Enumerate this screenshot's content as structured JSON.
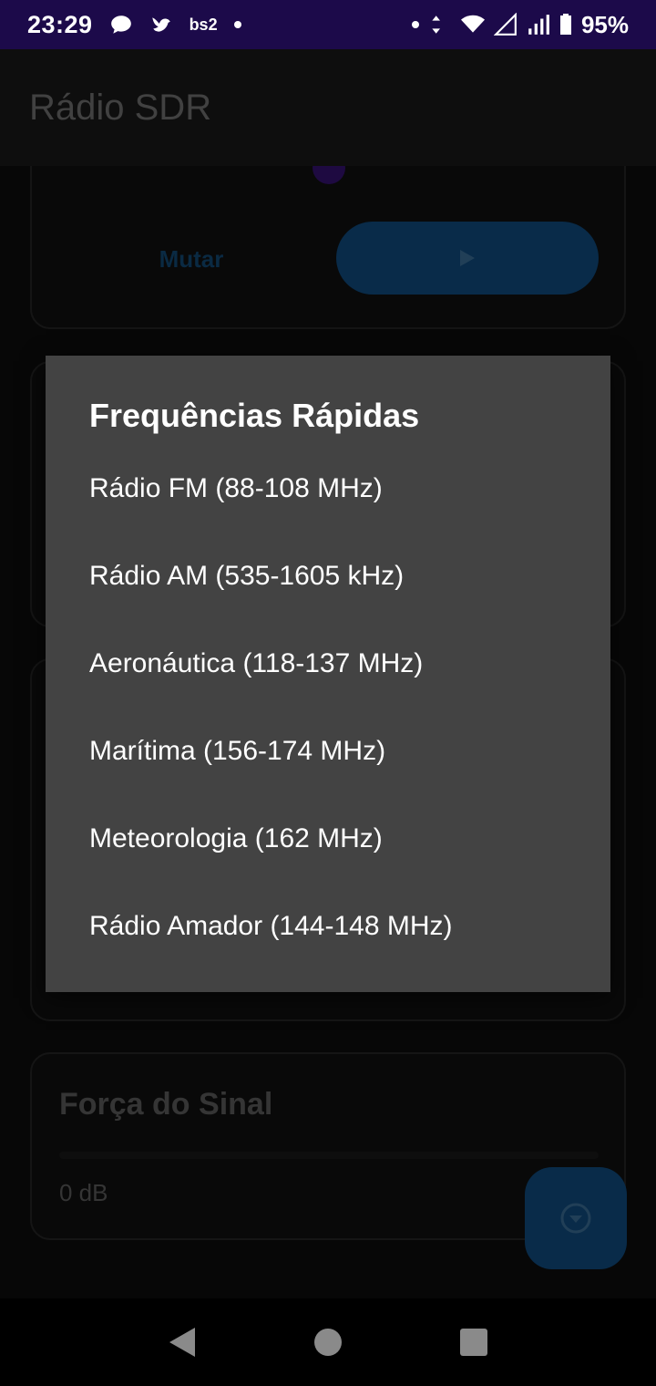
{
  "status_bar": {
    "time": "23:29",
    "carrier": "bs2",
    "battery": "95%",
    "icons": [
      "chat-bubble-icon",
      "bird-icon",
      "wifi-icon",
      "signal-icon",
      "battery-icon"
    ]
  },
  "app_bar": {
    "title": "Rádio SDR"
  },
  "controls": {
    "mute_label": "Mutar",
    "play_icon": "play-icon"
  },
  "signal": {
    "title": "Força do Sinal",
    "value": "0 dB",
    "level_fraction": 0
  },
  "dialog": {
    "title": "Frequências Rápidas",
    "items": [
      "Rádio FM (88-108 MHz)",
      "Rádio AM (535-1605 kHz)",
      "Aeronáutica (118-137 MHz)",
      "Marítima (156-174 MHz)",
      "Meteorologia (162 MHz)",
      "Rádio Amador (144-148 MHz)"
    ]
  },
  "fab": {
    "icon": "chevron-down-circle-icon"
  },
  "colors": {
    "status_bar": "#1c0a4a",
    "accent": "#0d3c66",
    "dialog_bg": "#434343"
  }
}
